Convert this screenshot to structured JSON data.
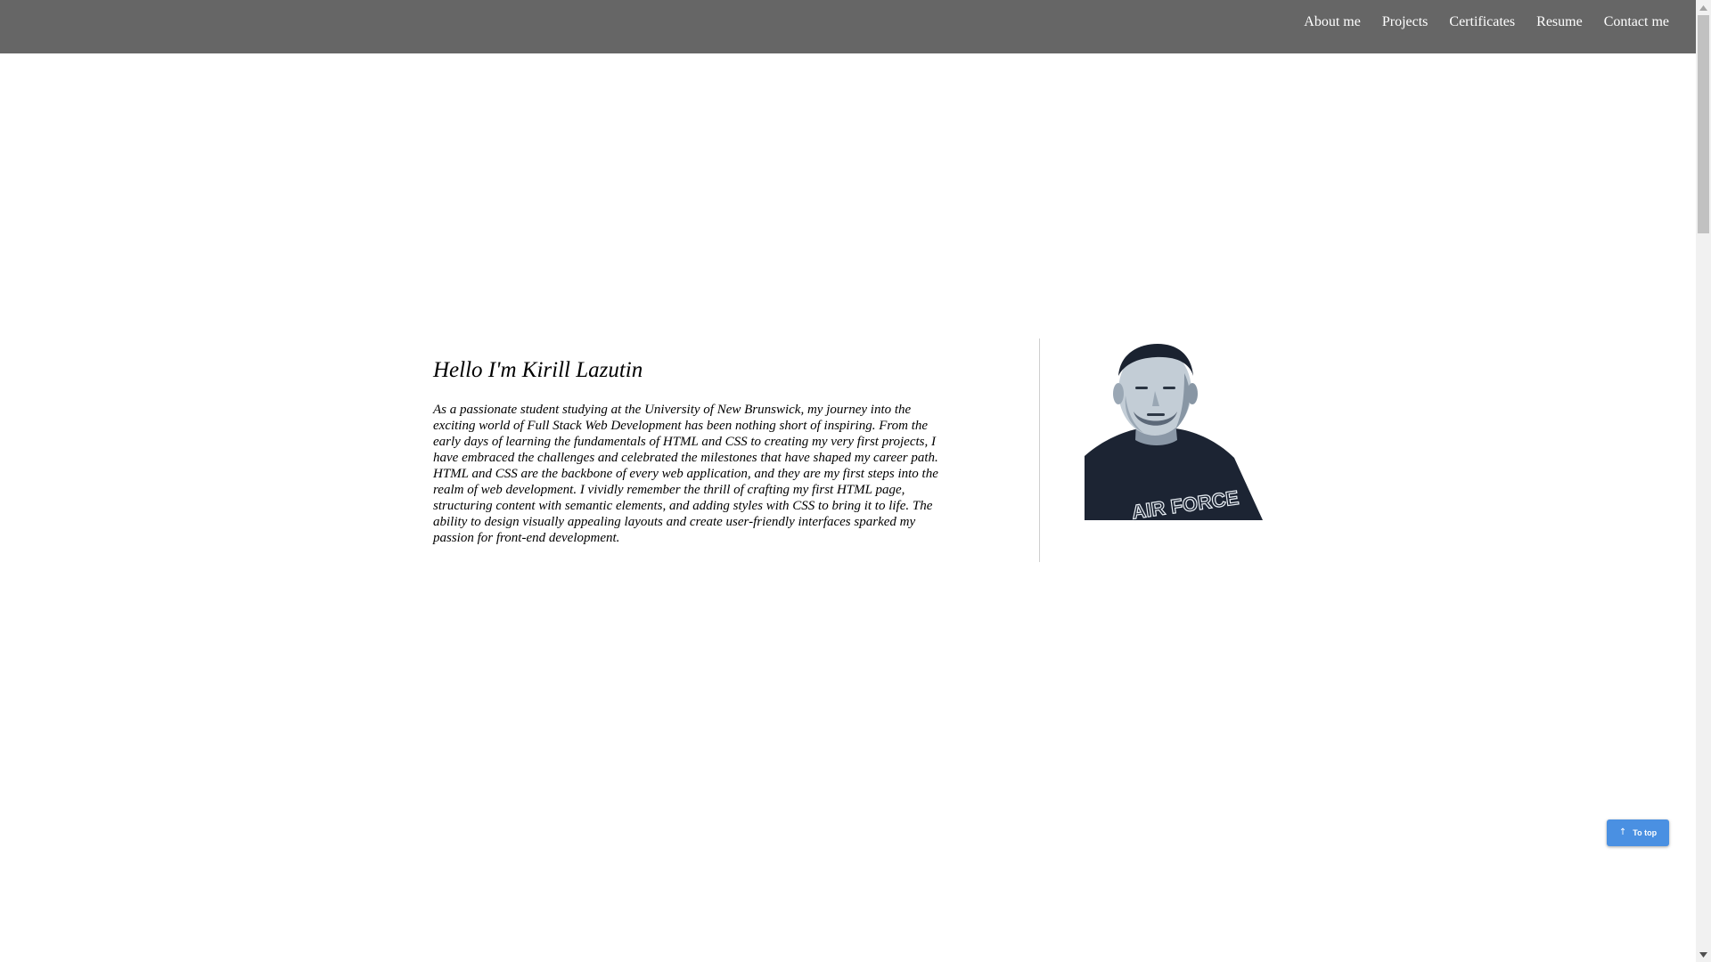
{
  "nav": {
    "items": [
      {
        "label": "About me"
      },
      {
        "label": "Projects"
      },
      {
        "label": "Certificates"
      },
      {
        "label": "Resume"
      },
      {
        "label": "Contact me"
      }
    ]
  },
  "about": {
    "heading": "Hello I'm Kirill Lazutin",
    "paragraph": "As a passionate student studying at the University of New Brunswick, my journey into the exciting world of Full Stack Web Development has been nothing short of inspiring. From the early days of learning the fundamentals of HTML and CSS to creating my very first projects, I have embraced the challenges and celebrated the milestones that have shaped my career path. HTML and CSS are the backbone of every web application, and they are my first steps into the realm of web development. I vividly remember the thrill of crafting my first HTML page, structuring content with semantic elements, and adding styles with CSS to bring it to life. The ability to design visually appealing layouts and create user-friendly interfaces sparked my passion for front-end development.",
    "portrait": {
      "shirt_text": "AIR FORCE"
    }
  },
  "to_top": {
    "label": "To top",
    "icon": "arrow-up-icon"
  },
  "colors": {
    "topbar": "#666666",
    "nav_text": "#ffffff",
    "to_top_bg": "#4a90e2",
    "divider": "#cfcfcf"
  }
}
